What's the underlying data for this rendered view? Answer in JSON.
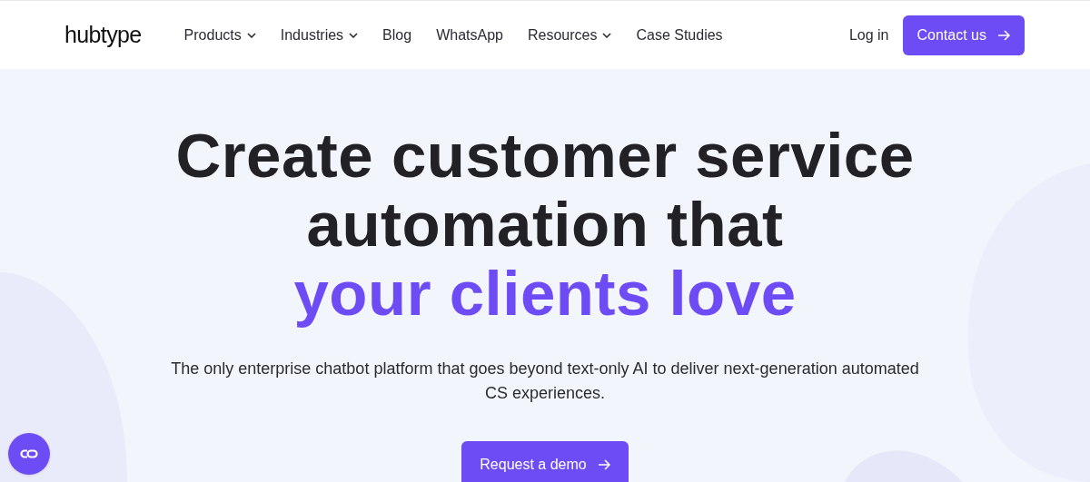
{
  "header": {
    "logo": "hubtype",
    "nav": [
      {
        "label": "Products",
        "kind": "dropdown"
      },
      {
        "label": "Industries",
        "kind": "dropdown"
      },
      {
        "label": "Blog",
        "kind": "link"
      },
      {
        "label": "WhatsApp",
        "kind": "link"
      },
      {
        "label": "Resources",
        "kind": "dropdown"
      },
      {
        "label": "Case Studies",
        "kind": "link"
      }
    ],
    "login": "Log in",
    "contact_button": "Contact us"
  },
  "hero": {
    "headline": [
      {
        "text": "Create customer service",
        "accent": false
      },
      {
        "text": "automation that",
        "accent": false
      },
      {
        "text": "your clients love",
        "accent": true
      }
    ],
    "subtitle": "The only enterprise chatbot platform that goes beyond text-only AI to deliver next-generation automated CS experiences.",
    "cta": "Request a demo"
  }
}
